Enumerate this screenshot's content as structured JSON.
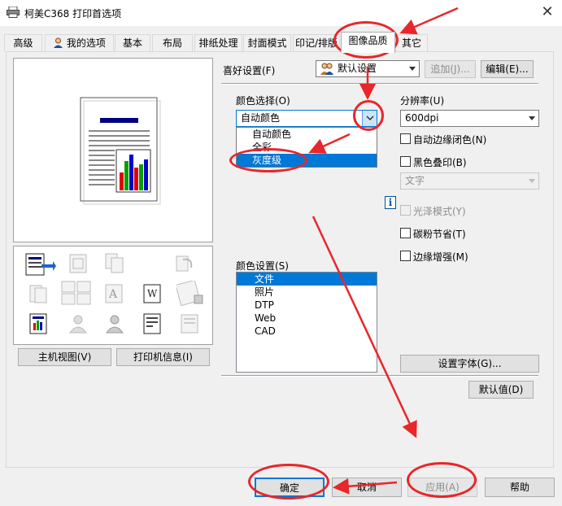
{
  "window": {
    "title": "柯美C368 打印首选项",
    "close_glyph": "✕"
  },
  "tabs": [
    {
      "label": "高级"
    },
    {
      "label": "我的选项"
    },
    {
      "label": "基本"
    },
    {
      "label": "布局"
    },
    {
      "label": "排纸处理"
    },
    {
      "label": "封面模式"
    },
    {
      "label": "印记/排版"
    },
    {
      "label": "图像品质",
      "active": true
    },
    {
      "label": "其它"
    }
  ],
  "favorites": {
    "label": "喜好设置(F)",
    "value": "默认设置",
    "add_button": "追加(J)...",
    "edit_button": "编辑(E)..."
  },
  "color_select": {
    "label": "颜色选择(O)",
    "value": "自动颜色",
    "options": [
      "自动颜色",
      "全彩",
      "灰度级"
    ],
    "highlighted": "灰度级"
  },
  "resolution": {
    "label": "分辨率(U)",
    "value": "600dpi"
  },
  "checkboxes": {
    "auto_trap": "自动边缘闭色(N)",
    "black_overprint": "黑色叠印(B)",
    "gloss_mode": "光泽模式(Y)",
    "toner_save": "碳粉节省(T)",
    "edge_enhance": "边缘增强(M)"
  },
  "overprint_combo": {
    "value": "文字"
  },
  "color_settings": {
    "label": "颜色设置(S)",
    "items": [
      "文件",
      "照片",
      "DTP",
      "Web",
      "CAD"
    ],
    "selected": "文件"
  },
  "buttons": {
    "font_settings": "设置字体(G)...",
    "defaults": "默认值(D)",
    "host_view": "主机视图(V)",
    "printer_info": "打印机信息(I)",
    "ok": "确定",
    "cancel": "取消",
    "apply": "应用(A)",
    "help": "帮助"
  },
  "info_glyph": "i",
  "colors": {
    "annotation_red": "#e8262b",
    "selection_blue": "#0078d7",
    "preview_navy": "#000080"
  }
}
